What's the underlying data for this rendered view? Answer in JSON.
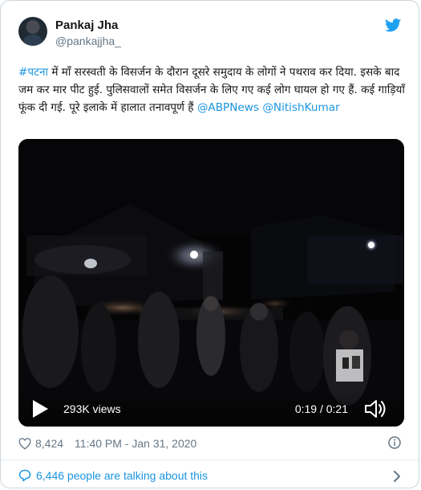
{
  "author": {
    "name": "Pankaj Jha",
    "handle": "@pankajjha_"
  },
  "tweet": {
    "hashtag": "#पटना",
    "body": " में माँ सरस्वती के विसर्जन के दौरान दूसरे समुदाय के लोगों ने पथराव कर दिया. इसके बाद जम कर मार पीट हुई. पुलिसवालों समेत विसर्जन के लिए गए कई लोग घायल हो गए हैं. कई गाड़ियाँ फूंक दी गई. पूरे इलाके में हालात तनावपूर्ण हैं ",
    "mention1": "@ABPNews",
    "mention2": "@NitishKumar"
  },
  "video": {
    "views": "293K views",
    "time": "0:19 / 0:21"
  },
  "meta": {
    "likes": "8,424",
    "timestamp": "11:40 PM - Jan 31, 2020"
  },
  "footer": {
    "talking": "6,446 people are talking about this"
  },
  "icons": {
    "brand": "twitter-bird-icon",
    "play": "play-icon",
    "volume": "volume-icon",
    "like": "heart-icon",
    "info": "info-icon",
    "reply": "speech-bubble-icon",
    "more": "chevron-right-icon"
  },
  "colors": {
    "link": "#1b95e0",
    "text": "#14171a",
    "secondary": "#657786",
    "border": "#ccd6dd"
  }
}
